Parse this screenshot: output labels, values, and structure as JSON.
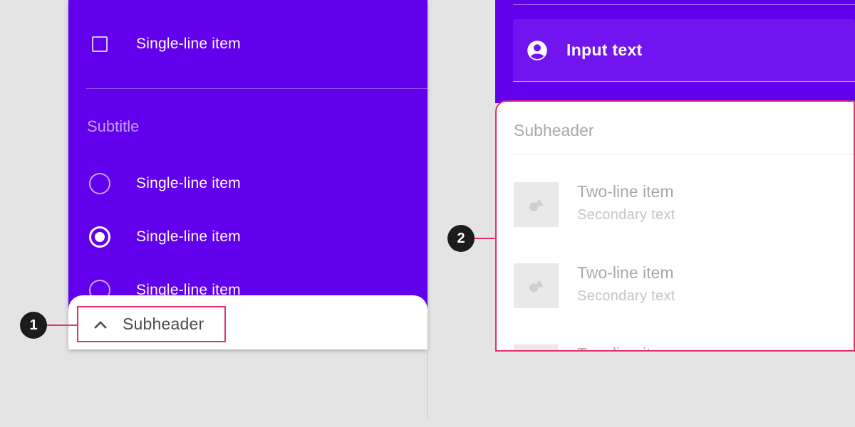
{
  "left_panel": {
    "items": [
      {
        "control": "checkbox",
        "checked": false,
        "label": "Single-line item"
      },
      {
        "control": "radio",
        "checked": false,
        "label": "Single-line item"
      },
      {
        "control": "radio",
        "checked": true,
        "label": "Single-line item"
      },
      {
        "control": "radio",
        "checked": false,
        "label": "Single-line item"
      }
    ],
    "subtitle": "Subtitle",
    "bottom_bar": {
      "icon": "chevron-up-icon",
      "label": "Subheader"
    }
  },
  "right_panel": {
    "input": {
      "icon": "account-circle-icon",
      "value": "Input text"
    },
    "sheet": {
      "subheader": "Subheader",
      "items": [
        {
          "icon": "image-placeholder-icon",
          "primary": "Two-line item",
          "secondary": "Secondary text"
        },
        {
          "icon": "image-placeholder-icon",
          "primary": "Two-line item",
          "secondary": "Secondary text"
        },
        {
          "icon": "image-placeholder-icon",
          "primary": "Two-line item",
          "secondary": ""
        }
      ]
    }
  },
  "callouts": [
    {
      "number": "1"
    },
    {
      "number": "2"
    }
  ],
  "colors": {
    "primary": "#6200ee",
    "input_fill": "#7214ef",
    "highlight": "#e0316c",
    "background": "#e4e4e4",
    "callout": "#1c1c1c"
  }
}
